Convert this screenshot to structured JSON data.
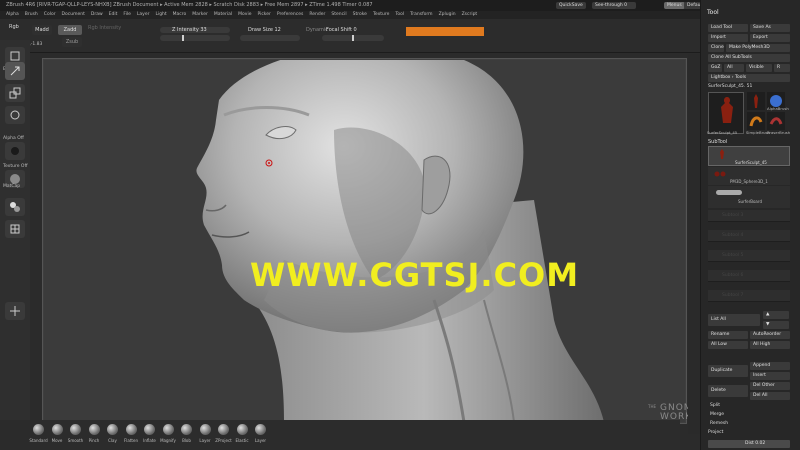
{
  "window": {
    "title": "ZBrush 4R6 [RIVR-TGAP-QLLP-LEYS-NHXB]    ZBrush Document    ▸ Active Mem 2828 ▸ Scratch Disk 2883 ▸ Free Mem 2897 ▸ ZTime 1.498 Timer 0.087",
    "quicksave": "QuickSave",
    "seethrough": "See-through",
    "seethrough_value": "0",
    "menus_btn": "Menus",
    "script_btn": "DefaultZScript"
  },
  "menubar": [
    "Alpha",
    "Brush",
    "Color",
    "Document",
    "Draw",
    "Edit",
    "File",
    "Layer",
    "Light",
    "Macro",
    "Marker",
    "Material",
    "Movie",
    "Picker",
    "Preferences",
    "Render",
    "Stencil",
    "Stroke",
    "Texture",
    "Tool",
    "Transform",
    "Zplugin",
    "Zscript"
  ],
  "topshelf": {
    "rgb": "Rgb",
    "coords": "0.273,0.96,-1.83",
    "madd": "Madd",
    "zadd": "Zadd",
    "zsub": "Zsub",
    "rgb_intensity": "Rgb Intensity",
    "z_intensity": "Z Intensity 33",
    "draw_size": "Draw Size 12",
    "focal": "Focal Shift 0",
    "dynamic": "Dynamic",
    "accent": "#e07a1f"
  },
  "lefttray": {
    "edit": "Edit",
    "draw": "Draw",
    "scale": "Scale",
    "rotate": "Rotate",
    "alpha": "Alpha Off",
    "texture": "Texture Off",
    "matcap": "MatCap"
  },
  "canvas": {
    "watermark": "WWW.CGTSJ.COM",
    "watermark_color": "#f1ee1f",
    "gnomon_the": "THE",
    "gnomon_1": "GNOMON",
    "gnomon_2": "WORKSHOP"
  },
  "toolpanel": {
    "title": "Tool",
    "load_tool": "Load Tool",
    "save_as": "Save As",
    "import": "Import",
    "export": "Export",
    "clone": "Clone",
    "make_polymesh": "Make PolyMesh3D",
    "clone_all": "Clone All SubTools",
    "goz": "GoZ",
    "all": "All",
    "visible": "Visible",
    "r": "R",
    "lightbox_tools": "Lightbox › Tools",
    "current_tool": "SurferSculpt_45. 51",
    "thumbs": [
      "SurferSculpt_45",
      "SimpleBrush",
      "EraserBrush",
      "AlphaBrush"
    ],
    "subtool_header": "SubTool",
    "subtools": [
      "SurferSculpt_45",
      "PM3D_Sphere3D_1",
      "SurferBoard"
    ],
    "empty_slots": [
      "Subtool 3",
      "Subtool 4",
      "Subtool 5",
      "Subtool 6",
      "Subtool 7"
    ],
    "list_all": "List All",
    "rename": "Rename",
    "autoreorder": "AutoReorder",
    "all_low": "All Low",
    "all_high": "All High",
    "duplicate": "Duplicate",
    "append": "Append",
    "insert": "Insert",
    "delete": "Delete",
    "del_other": "Del Other",
    "del_all": "Del All",
    "split": "Split",
    "merge": "Merge",
    "remesh": "Remesh",
    "project": "Project",
    "dist": "Dist 0.02"
  },
  "brushes": [
    "Standard",
    "Move",
    "Smooth",
    "Pinch",
    "Clay",
    "Flatten",
    "Inflate",
    "Magnify",
    "Blob",
    "Layer",
    "ZProject",
    "Elastic",
    "Layer"
  ]
}
